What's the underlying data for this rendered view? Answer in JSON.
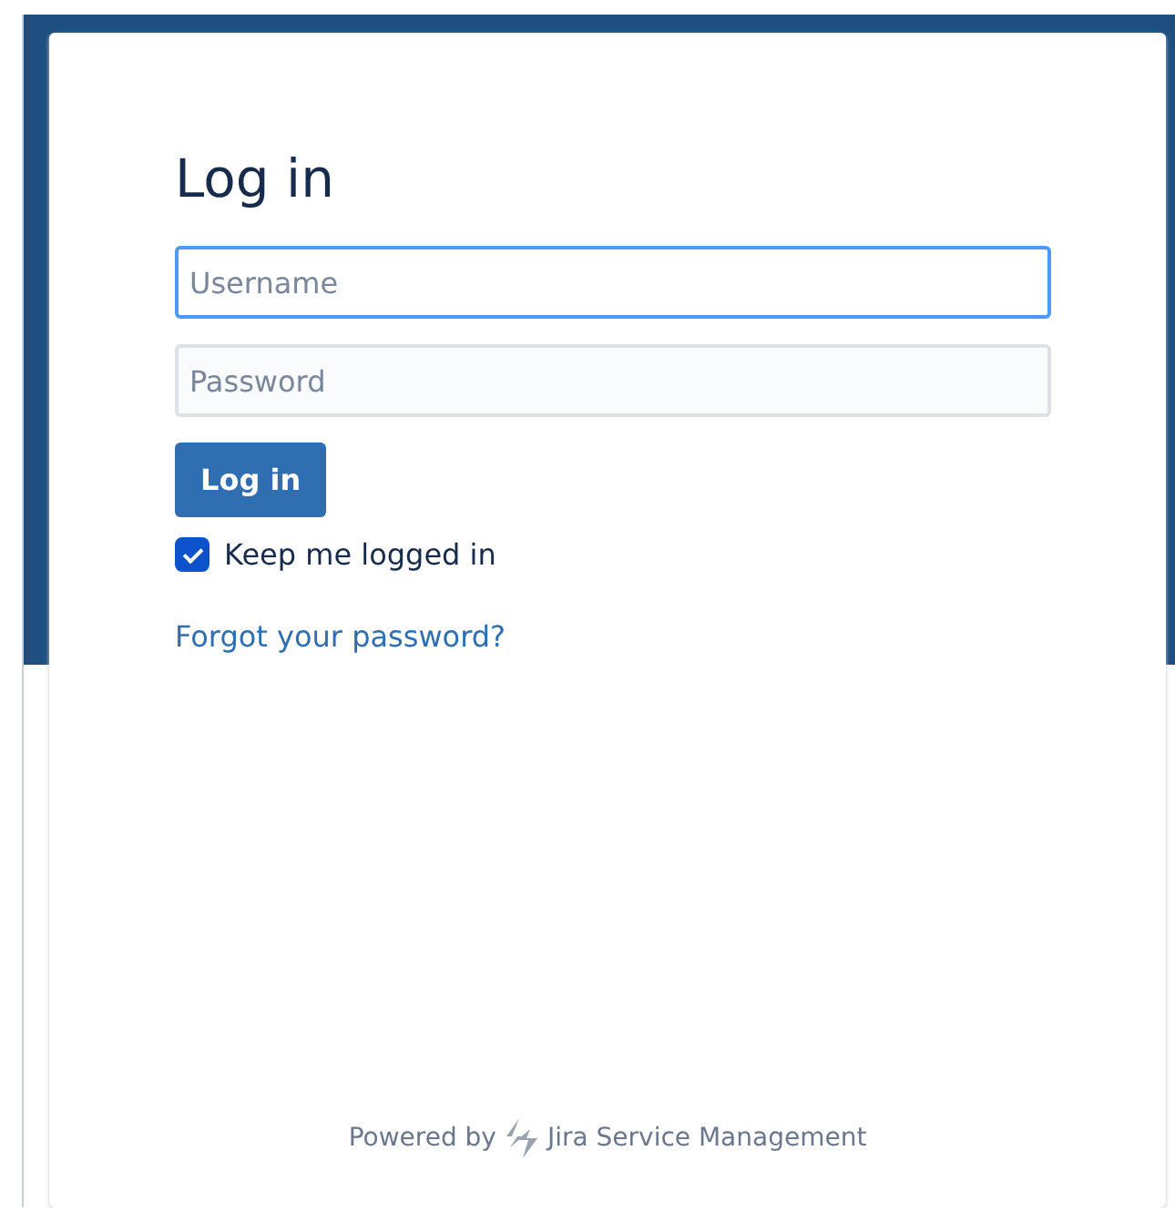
{
  "title": "Log in",
  "fields": [
    {
      "placeholder": "Username",
      "focused": true
    },
    {
      "placeholder": "Password",
      "focused": false
    }
  ],
  "submit": "Log in",
  "keep_logged_in": {
    "label": "Keep me logged in",
    "checked": true
  },
  "forgot_link": "Forgot your password?",
  "footer": {
    "prefix": "Powered by",
    "product": "Jira Service Management"
  }
}
